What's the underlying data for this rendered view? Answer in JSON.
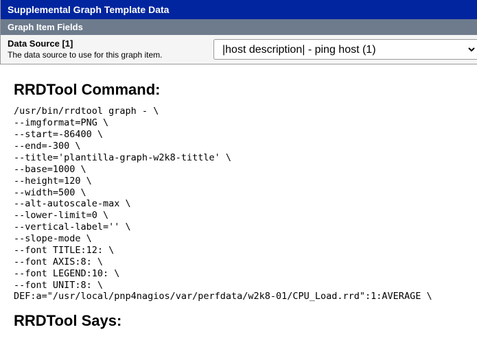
{
  "header": {
    "title": "Supplemental Graph Template Data",
    "subheader": "Graph Item Fields"
  },
  "field": {
    "label": "Data Source [1]",
    "description": "The data source to use for this graph item.",
    "selected": "|host description| - ping host (1)"
  },
  "sections": {
    "command_heading": "RRDTool Command:",
    "says_heading": "RRDTool Says:"
  },
  "command_text": "/usr/bin/rrdtool graph - \\\n--imgformat=PNG \\\n--start=-86400 \\\n--end=-300 \\\n--title='plantilla-graph-w2k8-tittle' \\\n--base=1000 \\\n--height=120 \\\n--width=500 \\\n--alt-autoscale-max \\\n--lower-limit=0 \\\n--vertical-label='' \\\n--slope-mode \\\n--font TITLE:12: \\\n--font AXIS:8: \\\n--font LEGEND:10: \\\n--font UNIT:8: \\\nDEF:a=\"/usr/local/pnp4nagios/var/perfdata/w2k8-01/CPU_Load.rrd\":1:AVERAGE \\"
}
